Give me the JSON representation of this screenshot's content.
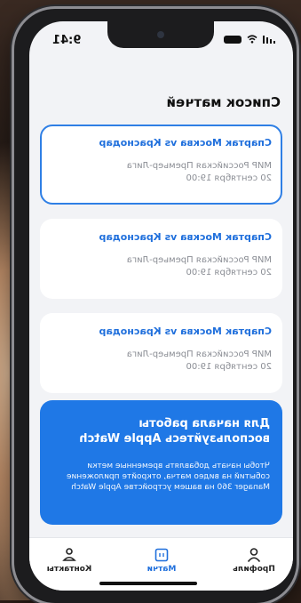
{
  "status": {
    "time": "9:41"
  },
  "page": {
    "title": "Список матчей"
  },
  "matches": [
    {
      "name": "Спартак Москва vs Краснодар",
      "league": "МИР Российская Премьер-Лига",
      "date": "20 сентября 19:00"
    },
    {
      "name": "Спартак Москва vs Краснодар",
      "league": "МИР Российская Премьер-Лига",
      "date": "20 сентября 19:00"
    },
    {
      "name": "Спартак Москва vs Краснодар",
      "league": "МИР Российская Премьер-Лига",
      "date": "20 сентября 19:00"
    }
  ],
  "promo": {
    "heading": "Для начала работы воспользуйтесь Apple Watch",
    "text": "Чтобы начать добавлять временные метки событий на видео матча, откройте приложение Manager 360 на вашем устройстве Apple Watch"
  },
  "tabs": [
    {
      "label": "Профиль",
      "icon": "person-icon"
    },
    {
      "label": "Матчи",
      "icon": "calendar-icon"
    },
    {
      "label": "Контакты",
      "icon": "contacts-icon"
    }
  ],
  "colors": {
    "accent": "#1f78e6",
    "background": "#f2f3f6"
  }
}
